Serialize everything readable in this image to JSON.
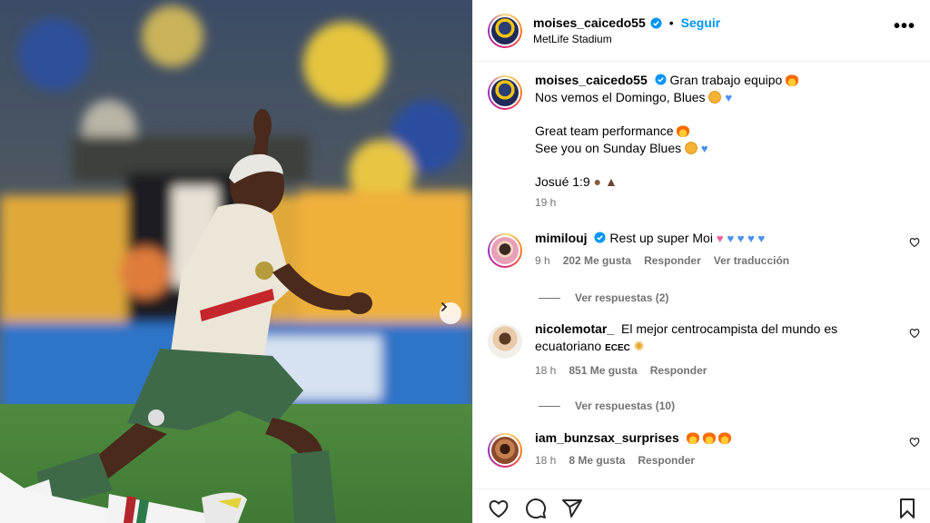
{
  "post": {
    "username": "moises_caicedo55",
    "follow_label": "Seguir",
    "separator": "•",
    "location": "MetLife Stadium",
    "more_label": "•••",
    "caption": {
      "line1": "Gran trabajo equipo",
      "line2": "Nos vemos el Domingo, Blues",
      "line3": "Great team performance",
      "line4": "See you on Sunday Blues",
      "line5": "Josué 1:9",
      "time": "19 h"
    }
  },
  "comments": [
    {
      "username": "mimilouj",
      "text": "Rest up super Moi",
      "time": "9 h",
      "likes": "202 Me gusta",
      "reply_label": "Responder",
      "translate_label": "Ver traducción",
      "replies_label": "Ver respuestas (2)"
    },
    {
      "username": "nicolemotar_",
      "text": "El mejor centrocampista del mundo es ecuatoriano",
      "flag_text": "ECEC",
      "time": "18 h",
      "likes": "851 Me gusta",
      "reply_label": "Responder",
      "replies_label": "Ver respuestas (10)"
    },
    {
      "username": "iam_bunzsax_surprises",
      "text": "",
      "time": "18 h",
      "likes": "8 Me gusta",
      "reply_label": "Responder"
    }
  ],
  "icons": {
    "verified": "verified-badge-icon",
    "like": "heart-icon",
    "comment": "comment-icon",
    "share": "share-icon",
    "save": "bookmark-icon",
    "next": "chevron-right-icon"
  },
  "colors": {
    "accent": "#0095f6",
    "muted": "#737373",
    "verified": "#0095f6"
  }
}
